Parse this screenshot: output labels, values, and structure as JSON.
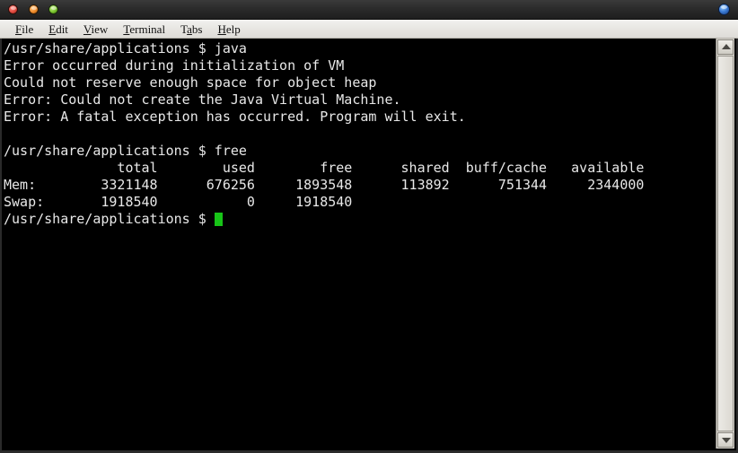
{
  "window": {
    "controls": {
      "close_label": "Close",
      "minimize_label": "Minimize",
      "maximize_label": "Maximize"
    }
  },
  "menubar": {
    "items": [
      {
        "mnemonic": "F",
        "rest": "ile"
      },
      {
        "mnemonic": "E",
        "rest": "dit"
      },
      {
        "mnemonic": "V",
        "rest": "iew"
      },
      {
        "mnemonic": "T",
        "rest": "erminal"
      },
      {
        "pre": "T",
        "mnemonic": "a",
        "rest": "bs"
      },
      {
        "mnemonic": "H",
        "rest": "elp"
      }
    ]
  },
  "terminal": {
    "colors": {
      "background": "#000000",
      "foreground": "#e8e8e8",
      "cursor": "#17c417"
    },
    "prompt": "/usr/share/applications $ ",
    "lines": [
      "/usr/share/applications $ java",
      "Error occurred during initialization of VM",
      "Could not reserve enough space for object heap",
      "Error: Could not create the Java Virtual Machine.",
      "Error: A fatal exception has occurred. Program will exit.",
      "",
      "/usr/share/applications $ free",
      "              total        used        free      shared  buff/cache   available",
      "Mem:        3321148      676256     1893548      113892      751344     2344000",
      "Swap:       1918540           0     1918540"
    ],
    "last_prompt": "/usr/share/applications $ ",
    "commands": [
      "java",
      "free"
    ],
    "free_output": {
      "headers": [
        "",
        "total",
        "used",
        "free",
        "shared",
        "buff/cache",
        "available"
      ],
      "rows": [
        {
          "label": "Mem:",
          "total": "3321148",
          "used": "676256",
          "free": "1893548",
          "shared": "113892",
          "buff_cache": "751344",
          "available": "2344000"
        },
        {
          "label": "Swap:",
          "total": "1918540",
          "used": "0",
          "free": "1918540",
          "shared": "",
          "buff_cache": "",
          "available": ""
        }
      ]
    },
    "java_error": {
      "line1": "Error occurred during initialization of VM",
      "line2": "Could not reserve enough space for object heap",
      "line3": "Error: Could not create the Java Virtual Machine.",
      "line4": "Error: A fatal exception has occurred. Program will exit."
    }
  },
  "scrollbar": {
    "up_arrow": "scroll-up",
    "down_arrow": "scroll-down"
  }
}
